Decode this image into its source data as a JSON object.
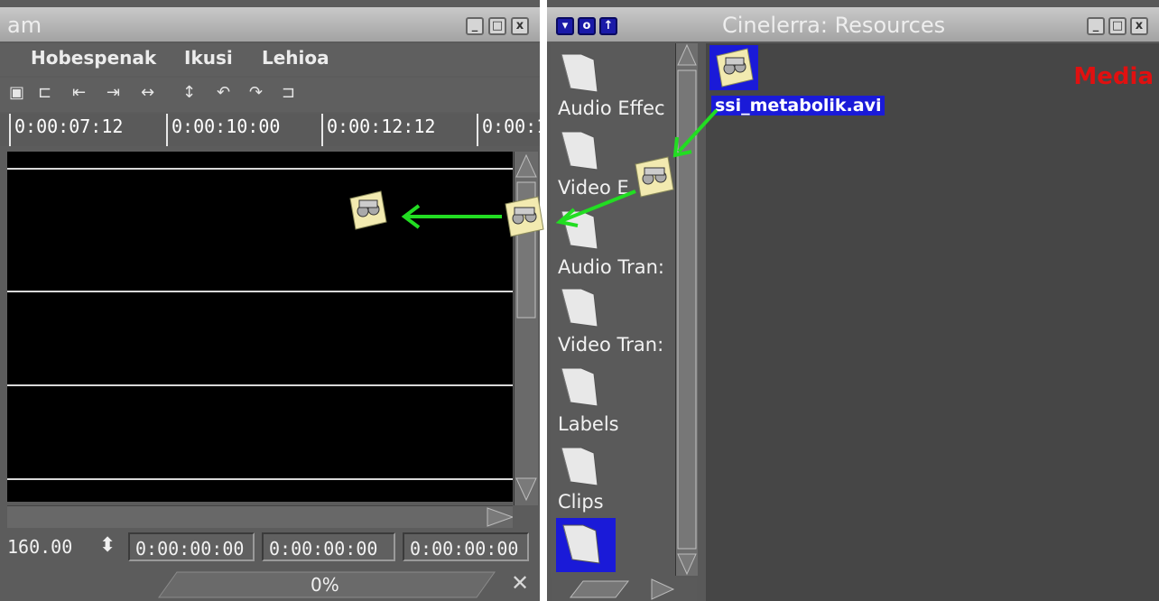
{
  "left_window": {
    "title": "am",
    "menu": [
      "Hobespenak",
      "Ikusi",
      "Lehioa"
    ],
    "ruler_labels": [
      "0:00:07:12",
      "0:00:10:00",
      "0:00:12:12",
      "0:00:1"
    ],
    "zoom_value": "160.00",
    "time_fields": [
      "0:00:00:00",
      "0:00:00:00",
      "0:00:00:00"
    ],
    "progress": "0%",
    "tools": [
      "paste-icon",
      "label-icon",
      "prev-label-icon",
      "next-label-icon",
      "fit-icon",
      "expand-icon",
      "undo-icon",
      "redo-icon",
      "loop-icon"
    ]
  },
  "right_window": {
    "title": "Cinelerra: Resources",
    "folders": [
      "Audio Effec",
      "Video E",
      "Audio Tran:",
      "Video Tran:",
      "Labels",
      "Clips"
    ],
    "panel_title": "Media",
    "media_item": "ssi_metabolik.avi"
  },
  "colors": {
    "arrow": "#22dd22",
    "selection": "#1a1ad8",
    "panel_title": "#e01010"
  }
}
